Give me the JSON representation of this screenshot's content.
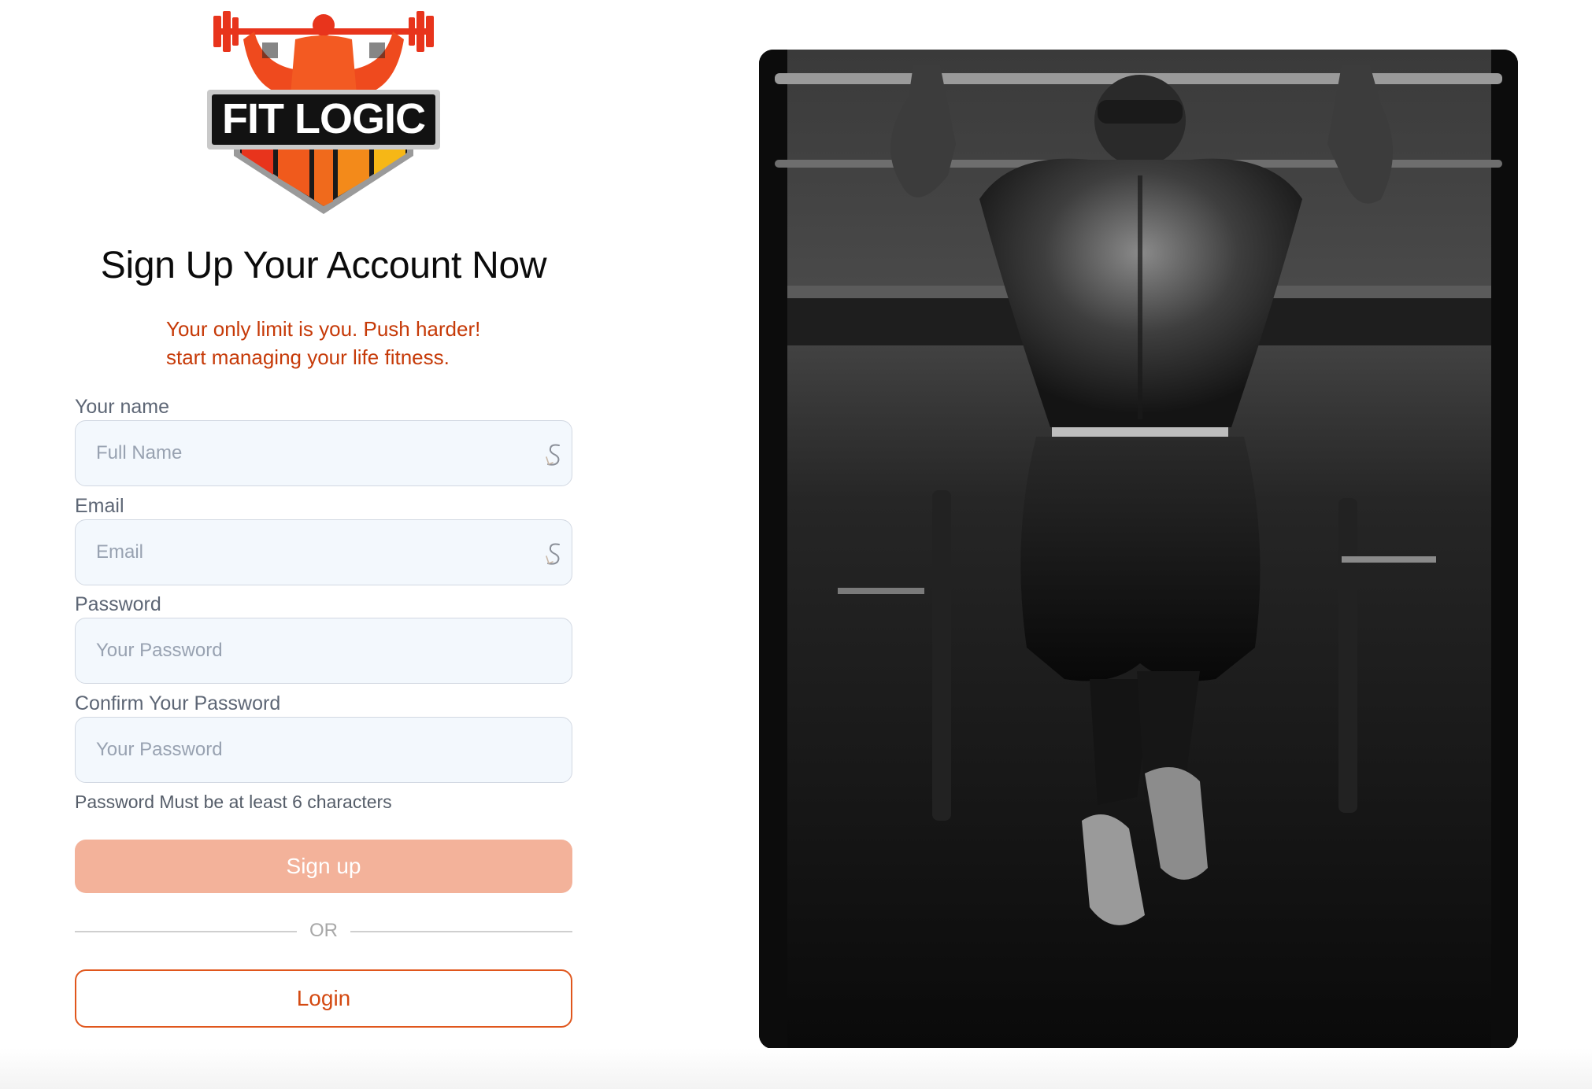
{
  "brand": {
    "logo_text": "FIT LOGIC",
    "colors": {
      "red": "#e8341c",
      "orange": "#f06a1c",
      "yellow": "#f6b716"
    }
  },
  "header": {
    "title": "Sign Up Your Account Now",
    "tagline_line1": "Your only limit is you. Push harder!",
    "tagline_line2": "start managing your life fitness."
  },
  "form": {
    "name": {
      "label": "Your name",
      "placeholder": "Full Name",
      "value": "",
      "icon": "autofill-icon"
    },
    "email": {
      "label": "Email",
      "placeholder": "Email",
      "value": "",
      "icon": "autofill-icon"
    },
    "password": {
      "label": "Password",
      "placeholder": "Your Password",
      "value": ""
    },
    "confirm_password": {
      "label": "Confirm Your Password",
      "placeholder": "Your Password",
      "value": ""
    },
    "password_hint": "Password Must be at least 6 characters",
    "signup_label": "Sign up",
    "divider_label": "OR",
    "login_label": "Login"
  },
  "theme": {
    "accent": "#e0561c",
    "signup_button_bg": "#f3b29a",
    "input_bg": "#f3f8fd",
    "tagline_color": "#c63a08"
  },
  "hero": {
    "image": "black-and-white photo of athlete doing pull-ups"
  }
}
